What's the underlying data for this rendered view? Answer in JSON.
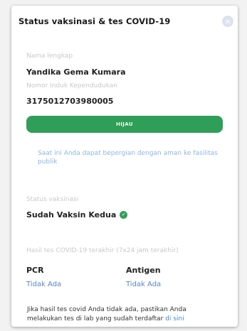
{
  "dialog": {
    "title": "Status vaksinasi & tes COVID-19",
    "close_glyph": "×"
  },
  "profile": {
    "name_label": "Nama lengkap",
    "name_value": "Yandika Gema Kumara",
    "nik_label": "Nomor Induk Kependudukan",
    "nik_value": "3175012703980005"
  },
  "status": {
    "badge_label": "HIJAU",
    "badge_color": "#2f9e58",
    "description": "Saat ini Anda dapat bepergian dengan aman ke fasilitas publik"
  },
  "vaccination": {
    "section_label": "Status vaksinasi",
    "value": "Sudah Vaksin Kedua",
    "icon": "check-circle-icon"
  },
  "tests": {
    "section_label": "Hasil tes COVID-19 terakhir (7x24 jam terakhir)",
    "items": [
      {
        "name": "PCR",
        "result": "Tidak Ada"
      },
      {
        "name": "Antigen",
        "result": "Tidak Ada"
      }
    ]
  },
  "footer": {
    "note_line1": "Jika hasil tes covid Anda tidak ada, pastikan Anda",
    "note_line2": "melakukan tes di lab yang sudah terdaftar",
    "link_label": "di sini"
  }
}
